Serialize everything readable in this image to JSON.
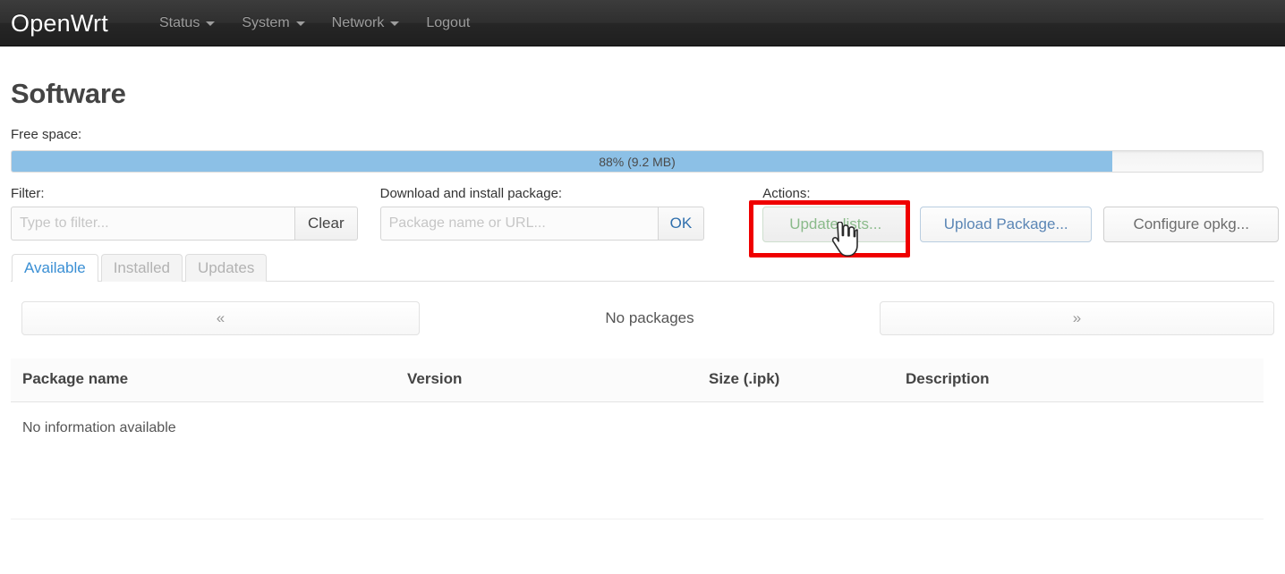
{
  "navbar": {
    "brand": "OpenWrt",
    "items": [
      {
        "label": "Status",
        "has_caret": true
      },
      {
        "label": "System",
        "has_caret": true
      },
      {
        "label": "Network",
        "has_caret": true
      },
      {
        "label": "Logout",
        "has_caret": false
      }
    ]
  },
  "page": {
    "title": "Software"
  },
  "free_space": {
    "label": "Free space:",
    "percent": 88,
    "text": "88% (9.2 MB)",
    "fill_color": "#8cc0e6"
  },
  "filter": {
    "label": "Filter:",
    "placeholder": "Type to filter...",
    "value": "",
    "clear_label": "Clear"
  },
  "download": {
    "label": "Download and install package:",
    "placeholder": "Package name or URL...",
    "value": "",
    "ok_label": "OK"
  },
  "actions": {
    "label": "Actions:",
    "update_lists_label": "Update lists...",
    "upload_package_label": "Upload Package...",
    "configure_opkg_label": "Configure opkg...",
    "highlight_color": "#ef0000",
    "update_lists_color": "#8aba8a",
    "upload_package_color": "#5b86b5"
  },
  "tabs": [
    {
      "label": "Available",
      "active": true
    },
    {
      "label": "Installed",
      "active": false
    },
    {
      "label": "Updates",
      "active": false
    }
  ],
  "pager": {
    "prev_label": "«",
    "next_label": "»",
    "status": "No packages"
  },
  "table": {
    "headers": [
      "Package name",
      "Version",
      "Size (.ipk)",
      "Description"
    ],
    "empty_message": "No information available",
    "rows": []
  }
}
